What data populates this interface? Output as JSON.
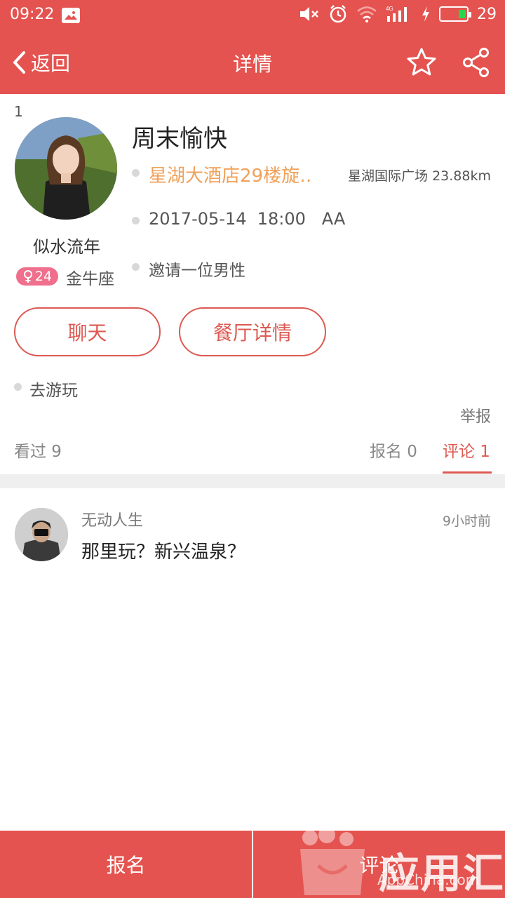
{
  "status_bar": {
    "time": "09:22",
    "network": "4G",
    "battery": "29"
  },
  "nav": {
    "back_label": "返回",
    "title": "详情"
  },
  "event": {
    "index": "1",
    "title": "周末愉快",
    "venue": "星湖大酒店29楼旋‥",
    "distance": "星湖国际广场 23.88km",
    "datetime": "2017-05-14  18:00   AA",
    "invite": "邀请一位男性",
    "tag": "去游玩"
  },
  "host": {
    "name": "似水流年",
    "age": "24",
    "zodiac": "金牛座"
  },
  "actions": {
    "chat": "聊天",
    "restaurant_details": "餐厅详情",
    "report": "举报"
  },
  "stats": {
    "views": "看过 9",
    "signups": "报名 0",
    "comments": "评论 1"
  },
  "comments": [
    {
      "user": "无动人生",
      "time": "9小时前",
      "text": "那里玩？新兴温泉？"
    }
  ],
  "bottom_bar": {
    "signup": "报名",
    "comment": "评论"
  },
  "watermark": {
    "text": "应用汇",
    "sub": "AppChina.com"
  },
  "colors": {
    "primary": "#e4534f",
    "accent_orange": "#f0a15a",
    "female_badge": "#ef6f8c"
  }
}
